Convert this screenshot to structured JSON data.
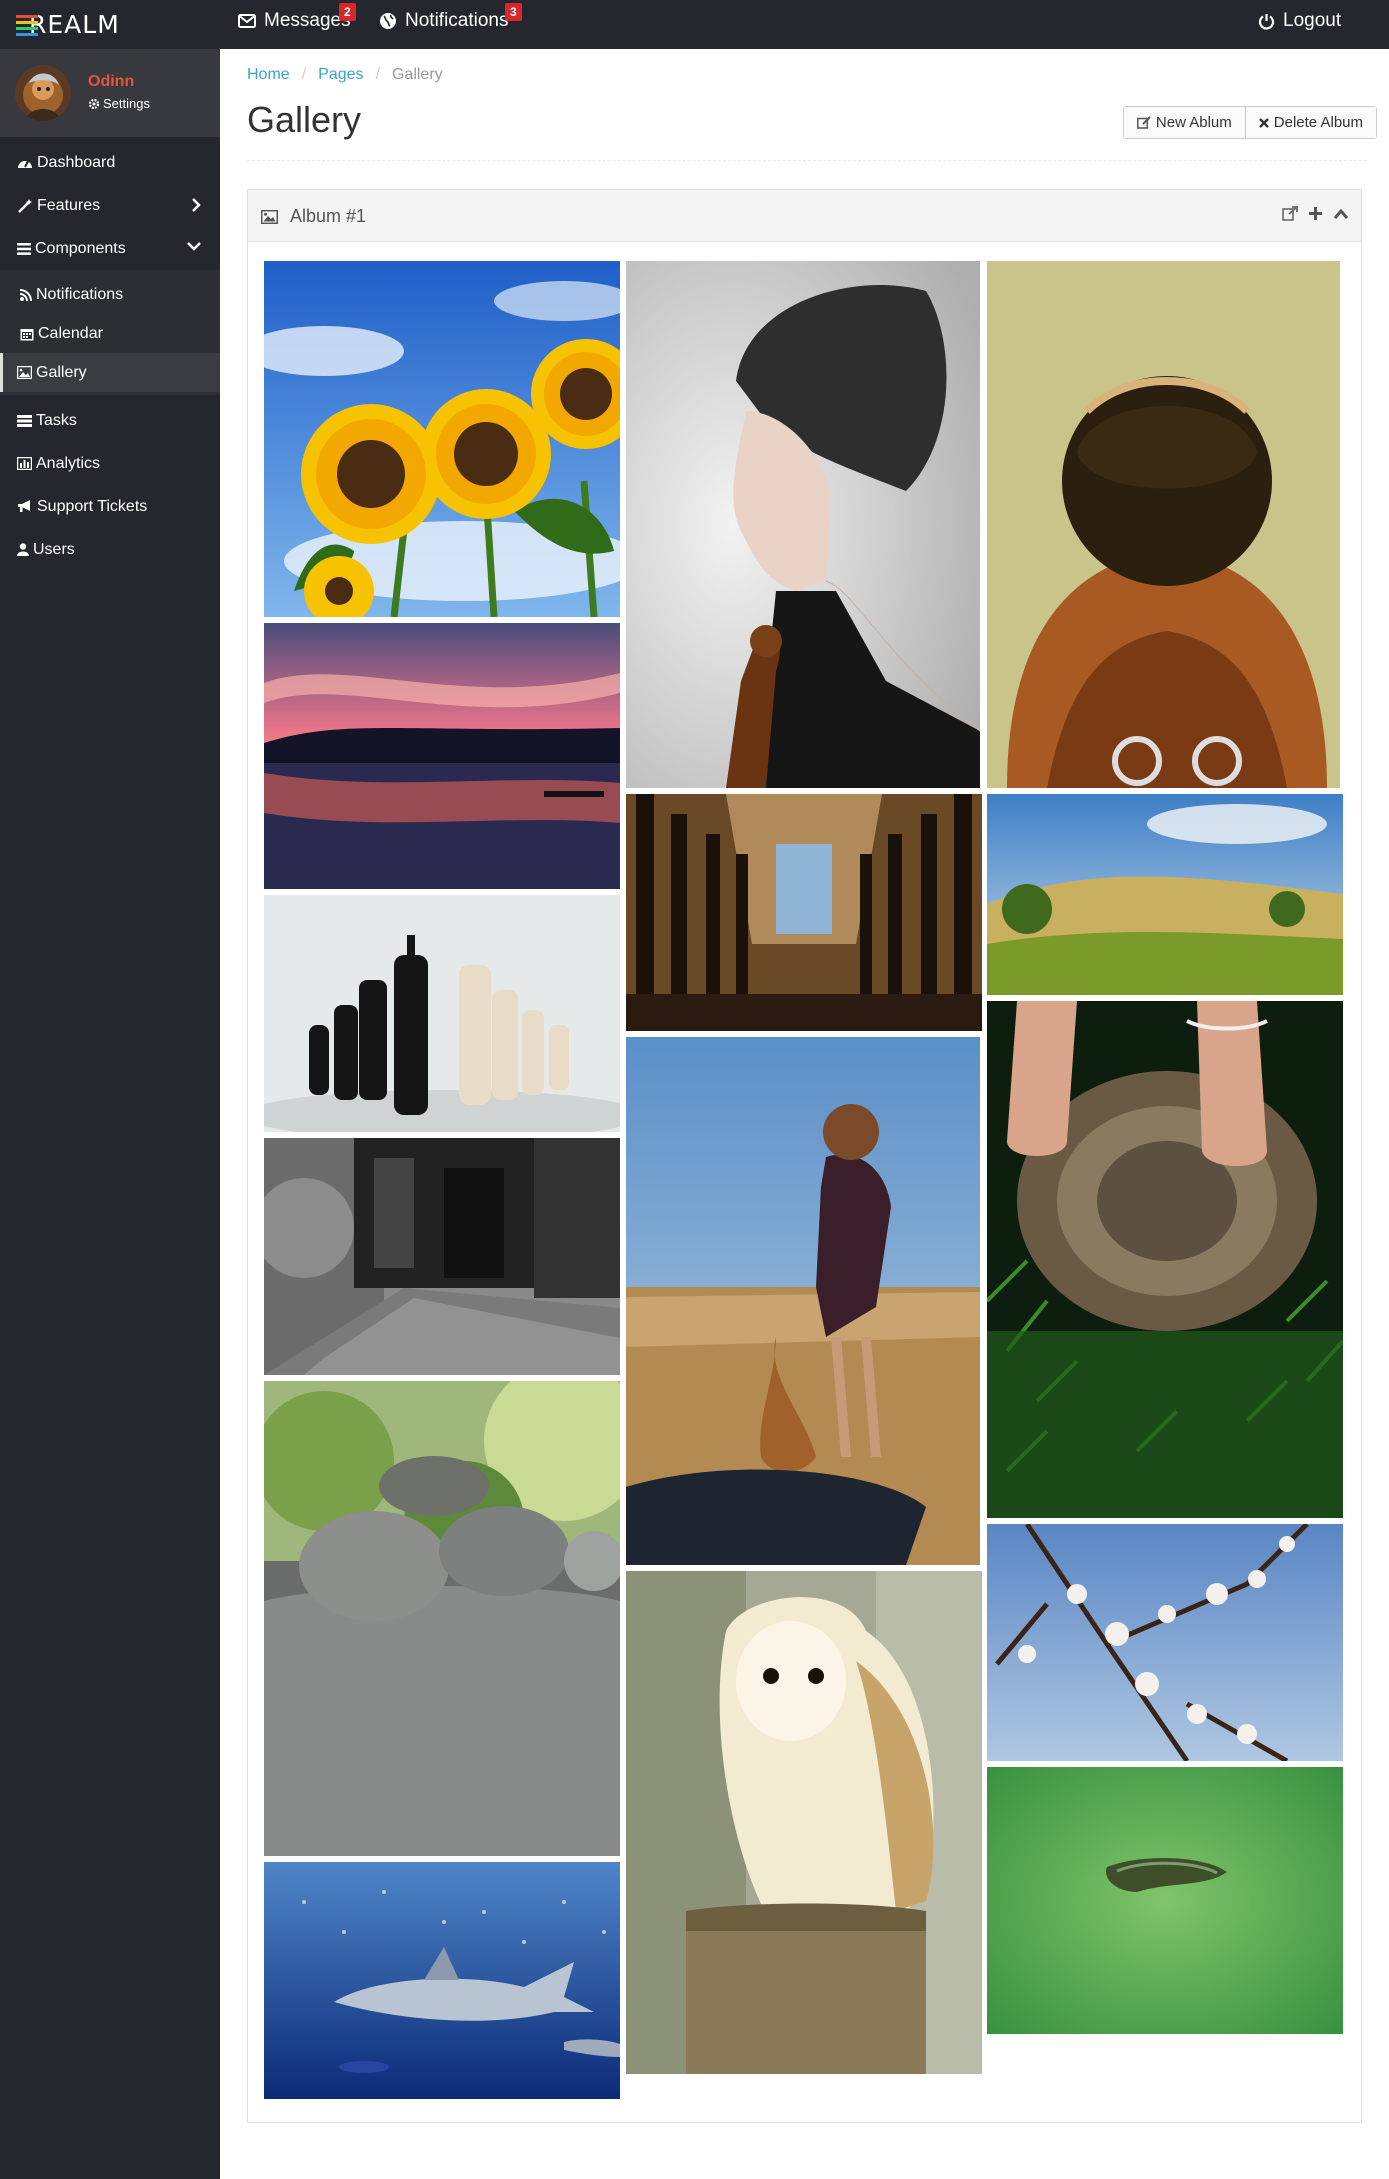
{
  "app": {
    "brand": "REALM"
  },
  "topbar": {
    "messages_label": "Messages",
    "messages_count": "2",
    "notifications_label": "Notifications",
    "notifications_count": "3",
    "logout_label": "Logout"
  },
  "user": {
    "name": "Odinn",
    "settings_label": "Settings"
  },
  "sidebar": {
    "dashboard": "Dashboard",
    "features": "Features",
    "components": "Components",
    "sub": {
      "notifications": "Notifications",
      "calendar": "Calendar",
      "gallery": "Gallery"
    },
    "tasks": "Tasks",
    "analytics": "Analytics",
    "support": "Support Tickets",
    "users": "Users"
  },
  "breadcrumb": {
    "home": "Home",
    "pages": "Pages",
    "current": "Gallery"
  },
  "page": {
    "title": "Gallery",
    "new_album": "New Ablum",
    "delete_album": "Delete Album"
  },
  "album": {
    "title": "Album #1",
    "photos": [
      "sunflowers",
      "woman with violin",
      "astronaut",
      "sunset over lake",
      "cathedral interior",
      "rolling green hills",
      "chess pieces",
      "bare feet on tree stump",
      "abandoned building",
      "girl with guitar in field",
      "stacked rocks",
      "cherry blossoms",
      "barn owl",
      "shark under water",
      "island aerial view"
    ]
  },
  "colors": {
    "accent": "#3aa0d1",
    "username": "#e5563d",
    "badge": "#d9262b",
    "sidebar": "#25272e"
  }
}
